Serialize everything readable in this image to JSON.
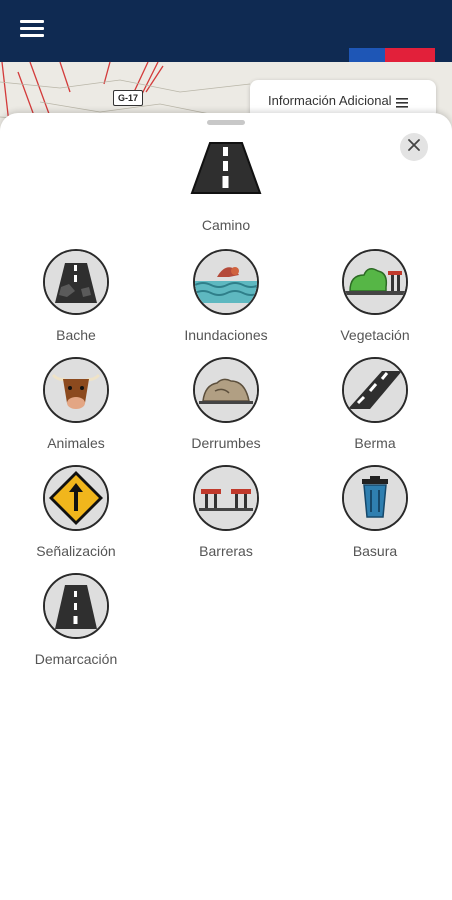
{
  "header": {
    "menu_icon": "hamburger-menu-icon",
    "flag_colors": {
      "blue": "#1e56b6",
      "red": "#e2203a",
      "bar": "#0f2a52"
    }
  },
  "map": {
    "road_badge": "G-17",
    "info_button": {
      "label": "Información Adicional",
      "icon": "list-icon"
    }
  },
  "sheet": {
    "close_icon": "close-icon",
    "featured": {
      "label": "Camino",
      "icon": "road-icon"
    },
    "categories": [
      {
        "label": "Bache",
        "icon": "pothole-icon"
      },
      {
        "label": "Inundaciones",
        "icon": "flood-icon"
      },
      {
        "label": "Vegetación",
        "icon": "vegetation-icon"
      },
      {
        "label": "Animales",
        "icon": "cow-icon"
      },
      {
        "label": "Derrumbes",
        "icon": "landslide-icon"
      },
      {
        "label": "Berma",
        "icon": "shoulder-road-icon"
      },
      {
        "label": "Señalización",
        "icon": "road-sign-icon"
      },
      {
        "label": "Barreras",
        "icon": "barrier-icon"
      },
      {
        "label": "Basura",
        "icon": "trash-icon"
      },
      {
        "label": "Demarcación",
        "icon": "road-marking-icon"
      }
    ]
  }
}
